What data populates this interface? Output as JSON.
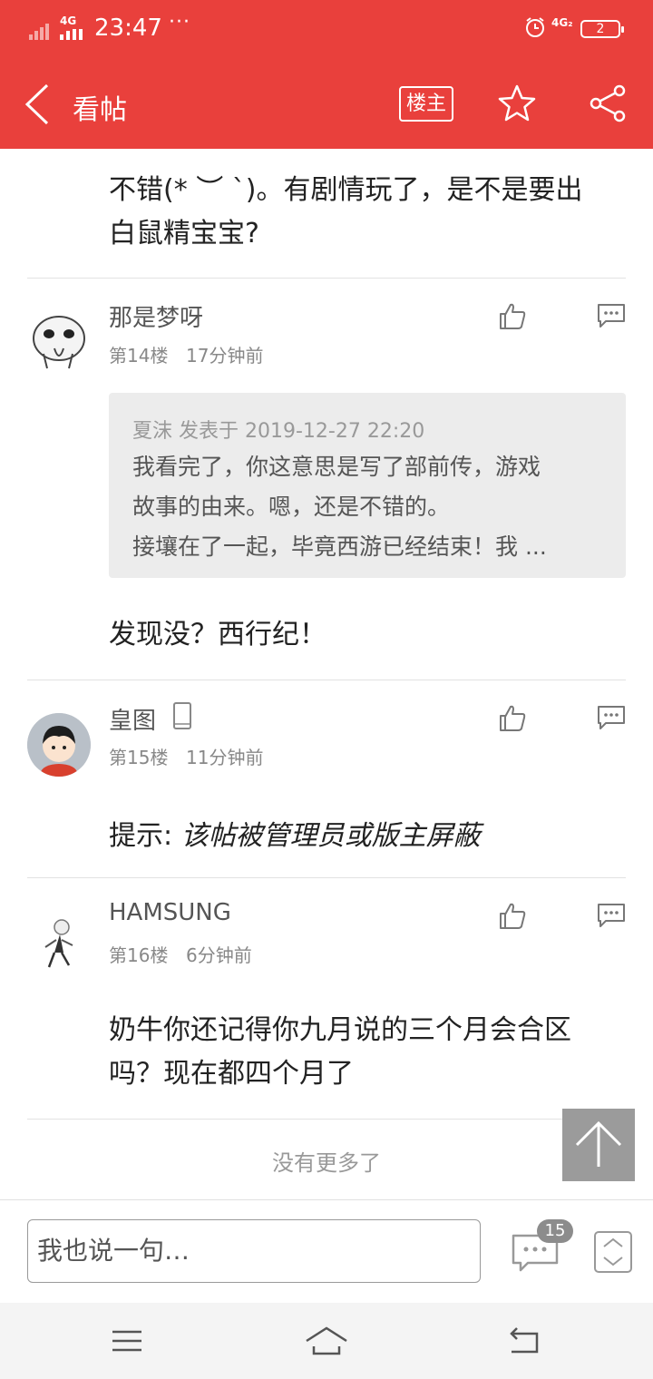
{
  "status_bar": {
    "network": "4G",
    "time": "23:47",
    "more": "···",
    "network2": "4G₂",
    "battery": "2"
  },
  "header": {
    "title": "看帖",
    "owner_button": "楼主"
  },
  "colors": {
    "brand_red": "#e9403c",
    "quote_bg": "#ececec"
  },
  "top_post": {
    "line1": "不错(* ︶ `)。有剧情玩了，是不是要出",
    "line2": "白鼠精宝宝?"
  },
  "posts": [
    {
      "author": "那是梦呀",
      "floor": "第14楼",
      "time": "17分钟前",
      "quote": {
        "header": "夏沫 发表于 2019-12-27 22:20",
        "lines": [
          "我看完了，你这意思是写了部前传，游戏",
          "故事的由来。嗯，还是不错的。",
          "接壤在了一起，毕竟西游已经结束！我 ..."
        ]
      },
      "content": "发现没？西行纪！"
    },
    {
      "author": "皇图",
      "floor": "第15楼",
      "time": "11分钟前",
      "hint_label": "提示: ",
      "hint_text": "该帖被管理员或版主屏蔽"
    },
    {
      "author": "HAMSUNG",
      "floor": "第16楼",
      "time": "6分钟前",
      "content_line1": "奶牛你还记得你九月说的三个月会合区",
      "content_line2": "吗？现在都四个月了"
    }
  ],
  "footer_message": "没有更多了",
  "input_bar": {
    "placeholder": "我也说一句…",
    "comment_count": "15"
  },
  "icons": [
    "back-icon",
    "star-icon",
    "share-icon",
    "like-icon",
    "reply-icon",
    "phone-icon",
    "arrow-up-icon",
    "comment-icon",
    "scroll-toggle-icon",
    "menu-icon",
    "home-icon",
    "return-icon",
    "alarm-icon"
  ]
}
